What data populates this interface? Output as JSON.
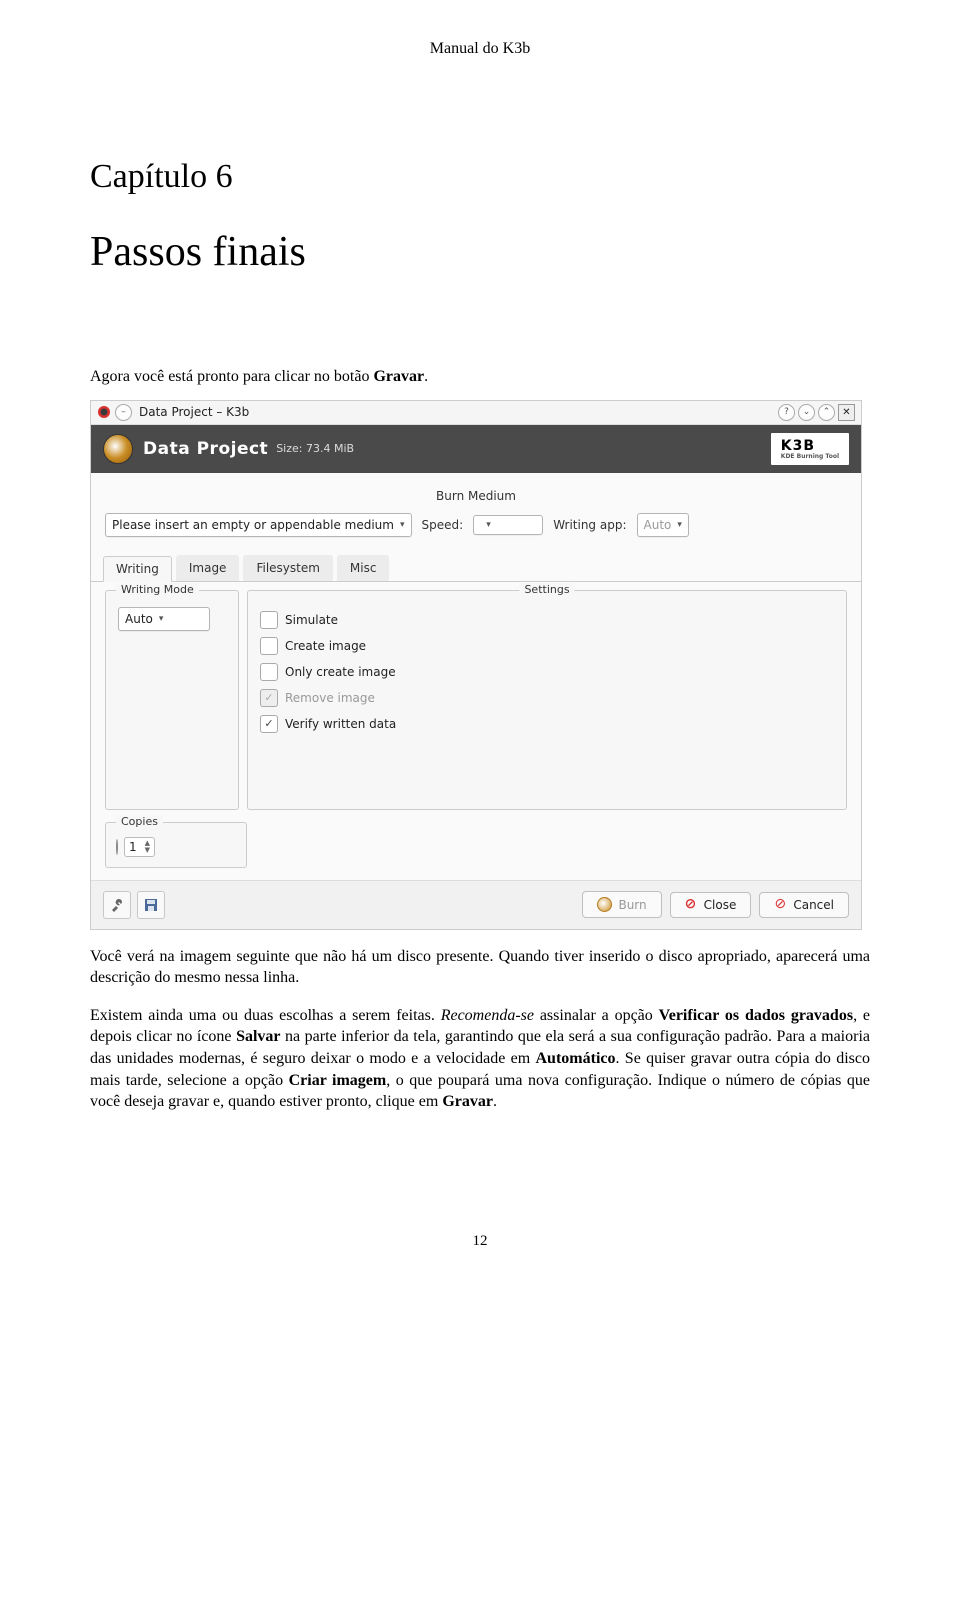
{
  "doc": {
    "header": "Manual do K3b",
    "chapter_num": "Capítulo 6",
    "chapter_title": "Passos finais",
    "page_number": "12"
  },
  "paragraphs": {
    "p1_pre": "Agora você está pronto para clicar no botão ",
    "p1_b": "Gravar",
    "p1_post": ".",
    "p2_pre": "Você verá na imagem seguinte que não há um disco presente. Quando tiver inserido o disco apropriado, aparecerá uma descrição do mesmo nessa linha.",
    "p3_pre": "Existem ainda uma ou duas escolhas a serem feitas. ",
    "p3_i": "Recomenda-se",
    "p3_mid1": " assinalar a opção ",
    "p3_b1": "Verificar os dados gravados",
    "p3_mid2": ", e depois clicar no ícone ",
    "p3_b2": "Salvar",
    "p3_mid3": " na parte inferior da tela, garantindo que ela será a sua configuração padrão. Para a maioria das unidades modernas, é seguro deixar o modo e a velocidade em ",
    "p3_b3": "Automático",
    "p3_mid4": ". Se quiser gravar outra cópia do disco mais tarde, selecione a opção ",
    "p3_b4": "Criar imagem",
    "p3_mid5": ", o que poupará uma nova configuração. Indique o número de cópias que você deseja gravar e, quando estiver pronto, clique em ",
    "p3_b5": "Gravar",
    "p3_post": "."
  },
  "ui": {
    "window_title": "Data Project – K3b",
    "banner_title": "Data Project",
    "banner_size": "Size: 73.4 MiB",
    "logo": "K3B",
    "logo_sub": "KDE Burning Tool",
    "burn_section": "Burn Medium",
    "medium_combo": "Please insert an empty or appendable medium",
    "speed_label": "Speed:",
    "writing_app_label": "Writing app:",
    "writing_app_value": "Auto",
    "tabs": [
      "Writing",
      "Image",
      "Filesystem",
      "Misc"
    ],
    "writing_mode_group": "Writing Mode",
    "writing_mode_value": "Auto",
    "settings_group": "Settings",
    "checks": {
      "simulate": "Simulate",
      "create_image": "Create image",
      "only_create": "Only create image",
      "remove_image": "Remove image",
      "verify": "Verify written data"
    },
    "copies_group": "Copies",
    "copies_value": "1",
    "btn_burn": "Burn",
    "btn_close": "Close",
    "btn_cancel": "Cancel"
  }
}
